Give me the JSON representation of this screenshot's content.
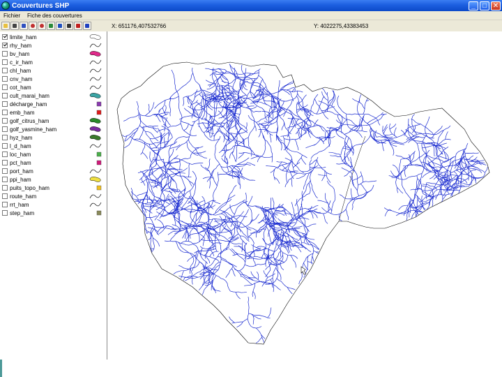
{
  "window": {
    "title": "Couvertures SHP",
    "controls": {
      "minimize": "_",
      "maximize": "□",
      "close": "✕"
    }
  },
  "menu": {
    "items": [
      "Fichier",
      "Fiche des couvertures"
    ]
  },
  "toolbar": {
    "tools": [
      "open-folder-icon",
      "camera-icon",
      "draw-line-icon",
      "zoom-in-icon",
      "zoom-out-icon",
      "pan-icon",
      "full-extent-icon",
      "binoculars-icon",
      "identify-icon",
      "help-icon"
    ]
  },
  "coords": {
    "x": "X: 651176,407532766",
    "y": "Y: 4022275,43383453"
  },
  "layers": [
    {
      "name": "limite_ham",
      "checked": true,
      "symbol": "polygon-outline",
      "color": "#ffffff"
    },
    {
      "name": "rhy_ham",
      "checked": true,
      "symbol": "line",
      "color": "#000000"
    },
    {
      "name": "bv_ham",
      "checked": false,
      "symbol": "polygon",
      "color": "#e02a8a"
    },
    {
      "name": "c_ir_ham",
      "checked": false,
      "symbol": "line",
      "color": "#000000"
    },
    {
      "name": "chl_ham",
      "checked": false,
      "symbol": "line",
      "color": "#000000"
    },
    {
      "name": "cnv_ham",
      "checked": false,
      "symbol": "line",
      "color": "#000000"
    },
    {
      "name": "cot_ham",
      "checked": false,
      "symbol": "line",
      "color": "#000000"
    },
    {
      "name": "cult_marai_ham",
      "checked": false,
      "symbol": "polygon",
      "color": "#3aa5a5"
    },
    {
      "name": "décharge_ham",
      "checked": false,
      "symbol": "square",
      "color": "#8a3ab0"
    },
    {
      "name": "emb_ham",
      "checked": false,
      "symbol": "square",
      "color": "#e01a1a"
    },
    {
      "name": "golf_citrus_ham",
      "checked": false,
      "symbol": "polygon",
      "color": "#2a8a2a"
    },
    {
      "name": "golf_yasmine_ham",
      "checked": false,
      "symbol": "polygon",
      "color": "#7a2aa0"
    },
    {
      "name": "hyz_ham",
      "checked": false,
      "symbol": "polygon",
      "color": "#3a7a2a"
    },
    {
      "name": "l_d_ham",
      "checked": false,
      "symbol": "line",
      "color": "#000000"
    },
    {
      "name": "loc_ham",
      "checked": false,
      "symbol": "square",
      "color": "#4ab04a"
    },
    {
      "name": "pct_ham",
      "checked": false,
      "symbol": "square",
      "color": "#d01a7a"
    },
    {
      "name": "port_ham",
      "checked": false,
      "symbol": "line",
      "color": "#000000"
    },
    {
      "name": "ppi_ham",
      "checked": false,
      "symbol": "polygon",
      "color": "#f0e040"
    },
    {
      "name": "puits_topo_ham",
      "checked": false,
      "symbol": "square",
      "color": "#f0c020"
    },
    {
      "name": "route_ham",
      "checked": false,
      "symbol": "line",
      "color": "#000000"
    },
    {
      "name": "rrt_ham",
      "checked": false,
      "symbol": "line",
      "color": "#000000"
    },
    {
      "name": "step_ham",
      "checked": false,
      "symbol": "square",
      "color": "#8a8a5a"
    }
  ],
  "map": {
    "boundary_color": "#000000",
    "river_color": "#1a2bd0",
    "fill_color": "#ffffff"
  }
}
